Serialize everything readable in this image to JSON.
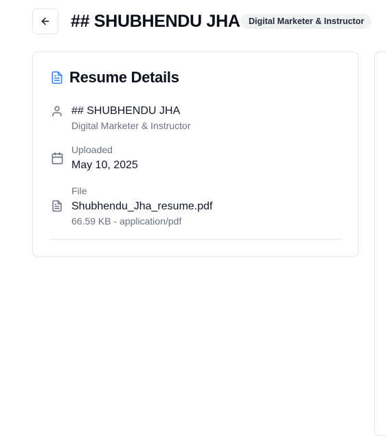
{
  "header": {
    "title": "## SHUBHENDU JHA",
    "role_badge": "Digital Marketer & Instructor"
  },
  "details": {
    "title": "Resume Details",
    "name": "## SHUBHENDU JHA",
    "role": "Digital Marketer & Instructor",
    "uploaded_label": "Uploaded",
    "uploaded_date": "May 10, 2025",
    "file_label": "File",
    "file_name": "Shubhendu_Jha_resume.pdf",
    "file_meta": "66.59 KB - application/pdf"
  },
  "icons": {
    "back": "arrow-left-icon",
    "card": "file-text-icon",
    "name": "user-icon",
    "uploaded": "calendar-icon",
    "file": "file-text-icon"
  },
  "colors": {
    "accent": "#3b82f6",
    "muted_text": "#6b7280",
    "badge_bg": "#f1f2f4"
  }
}
